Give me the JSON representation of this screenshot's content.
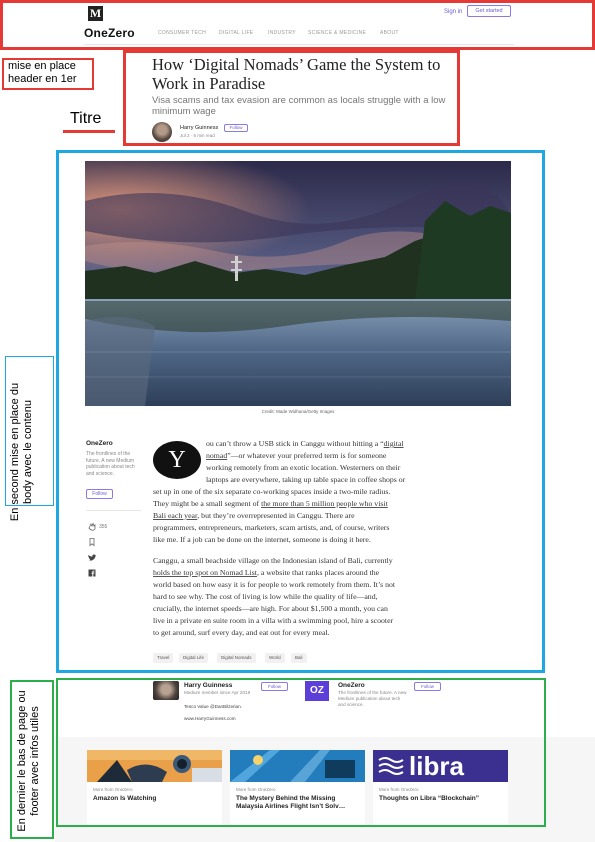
{
  "header": {
    "logo_letter": "M",
    "sign_in": "Sign in",
    "get_started": "Get started",
    "brand": "OneZero",
    "nav": [
      "CONSUMER TECH",
      "DIGITAL LIFE",
      "INDUSTRY",
      "SCIENCE & MEDICINE",
      "ABOUT"
    ]
  },
  "article": {
    "title": "How ‘Digital Nomads’ Game the System to Work in Paradise",
    "subtitle": "Visa scams and tax evasion are common as locals struggle with a low minimum wage",
    "author": "Harry Guinness",
    "follow": "Follow",
    "meta": "Jul 2 · 6 min read",
    "image_credit": "Credit: Made Widhana/Getty Images",
    "dropcap": "Y",
    "p1_l1a": "ou can’t throw a USB stick in Canggu without hitting a “",
    "p1_l1_link": "digital",
    "p1_l2_link": "nomad",
    "p1_l2b": "”—or whatever your preferred term is for someone",
    "p1_l3": "working remotely from an exotic location. Westerners on their",
    "p1_l4": "laptops are everywhere, taking up table space in coffee shops or",
    "p1_l5": "set up in one of the six separate co-working spaces inside a two-mile radius.",
    "p1_l6a": "They might be a small segment of ",
    "p1_l6_link": "the more than 5 million people who visit",
    "p1_l7_link": "Bali each year",
    "p1_l7b": ", but they’re overrepresented in Canggu. There are",
    "p1_l8": "programmers, entrepreneurs, marketers, scam artists, and, of course, writers",
    "p1_l9": "like me. If a job can be done on the internet, someone is doing it here.",
    "p2_l1": "Canggu, a small beachside village on the Indonesian island of Bali, currently",
    "p2_l2_link": "holds the top spot on Nomad List",
    "p2_l2b": ", a website that ranks places around the",
    "p2_l3": "world based on how easy it is for people to work remotely from them. It’s not",
    "p2_l4": "hard to see why. The cost of living is low while the quality of life—and,",
    "p2_l5": "crucially, the internet speeds—are high. For about $1,500 a month, you can",
    "p2_l6": "live in a private en suite room in a villa with a swimming pool, hire a scooter",
    "p2_l7": "to get around, surf every day, and eat out for every meal.",
    "tags": [
      "Travel",
      "Digital Life",
      "Digital Nomads",
      "World",
      "Bali"
    ]
  },
  "sidebar": {
    "publication": "OneZero",
    "description": "The frontlines of the future. A new Medium publication about tech and science.",
    "follow": "Follow",
    "claps": "355",
    "icons": [
      "clap-icon",
      "bookmark-icon",
      "twitter-icon",
      "facebook-icon"
    ]
  },
  "footer": {
    "author_name": "Harry Guinness",
    "author_since": "Medium member since Apr 2019",
    "author_bio_1": "Tesco Value @DanBilzerian.",
    "author_bio_2": "www.HarryGuinness.com",
    "author_follow": "Follow",
    "pub_logo": "OZ",
    "pub_name": "OneZero",
    "pub_desc": "The frontlines of the future. A new Medium publication about tech and science.",
    "pub_follow": "Follow"
  },
  "more_from": [
    {
      "kicker": "More from OneZero",
      "title": "Amazon Is Watching"
    },
    {
      "kicker": "More from OneZero",
      "title": "The Mystery Behind the Missing Malaysia Airlines Flight Isn’t Solv…"
    },
    {
      "kicker": "More from OneZero",
      "title": "Thoughts on Libra “Blockchain”"
    }
  ],
  "card_image_text": {
    "libra": "libra"
  },
  "annotations": {
    "header_note": "mise en place header en 1er",
    "title_note": "Titre",
    "body_note": "En second mise en place du body avec le contenu",
    "footer_note": "En dernier le bas de page ou footer avec infos utiles"
  },
  "colors": {
    "accent": "#6b5bd6",
    "annotation_red": "#e53935",
    "annotation_blue": "#1ea7e1",
    "annotation_green": "#2eae4a"
  }
}
